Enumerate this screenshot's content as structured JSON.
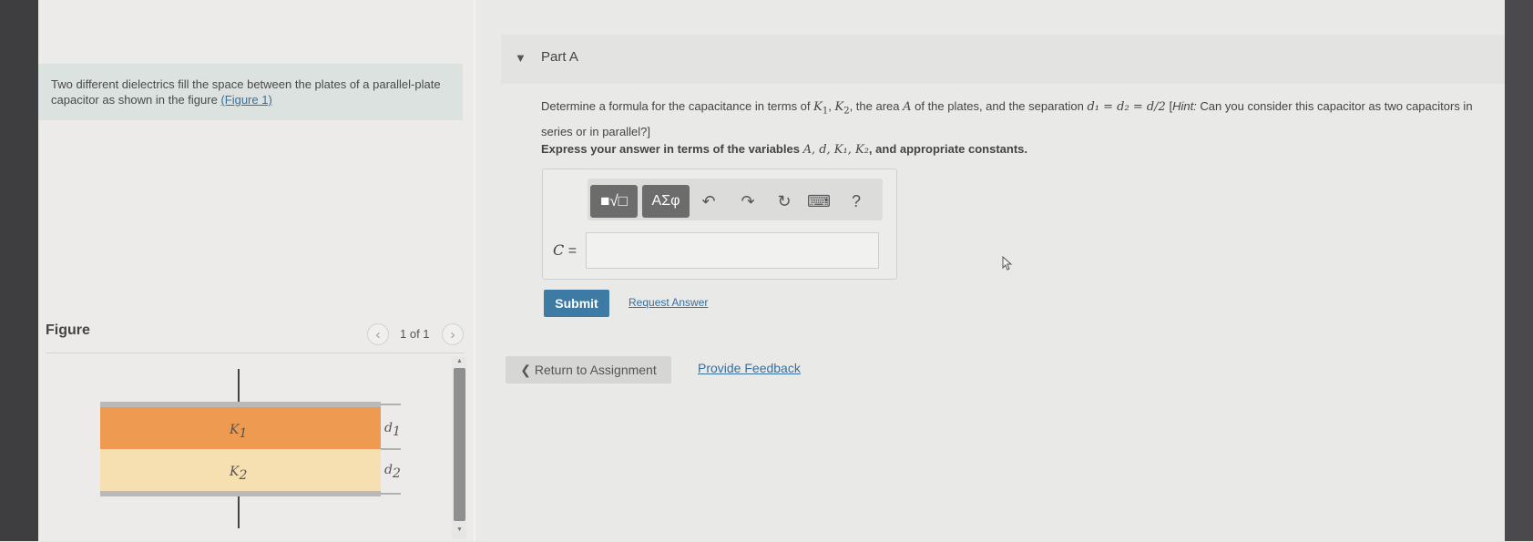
{
  "left_panel": {
    "intro_text": "Two different dielectrics fill the space between the plates of a parallel-plate capacitor as shown in the figure ",
    "intro_link": "(Figure 1)",
    "figure_title": "Figure",
    "figure_pager": "1 of 1",
    "prev_icon": "chevron-left-icon",
    "next_icon": "chevron-right-icon"
  },
  "figure": {
    "layers": [
      {
        "label": "K",
        "sub": "1",
        "color": "#ef9a51",
        "thickness_label": "d",
        "thickness_sub": "1"
      },
      {
        "label": "K",
        "sub": "2",
        "color": "#f6dfb1",
        "thickness_label": "d",
        "thickness_sub": "2"
      }
    ],
    "plate_color": "#b9b9b9"
  },
  "part_a": {
    "title": "Part A",
    "question_1": "Determine a formula for the capacitance in terms of ",
    "q_K1": "K",
    "q_K1_sub": "1",
    "q_K2": "K",
    "q_K2_sub": "2",
    "question_2": ", the area ",
    "q_A": "A",
    "question_3": " of the plates, and the separation ",
    "q_eq": "d₁ = d₂ = d/2",
    "question_4": " [",
    "q_hint": "Hint:",
    "question_5": " Can you consider this capacitor as two capacitors in series or in parallel?]",
    "instruction_prefix": "Express your answer in terms of the variables ",
    "instruction_vars": "A, d, K₁, K₂",
    "instruction_suffix": ", and appropriate constants.",
    "toolbar": {
      "template_label": "■√□",
      "greek_label": "ΑΣφ",
      "undo_symbol": "↶",
      "redo_symbol": "↷",
      "reset_symbol": "↻",
      "keyboard_symbol": "⌨",
      "help_symbol": "?"
    },
    "answer_label": "C",
    "answer_equals": " =",
    "answer_value": "",
    "submit_label": "Submit",
    "request_label": "Request Answer"
  },
  "footer": {
    "return_label": "❮ Return to Assignment",
    "feedback_label": "Provide Feedback"
  },
  "colors": {
    "accent": "#3d7aa4",
    "link": "#3a6f9c",
    "intro_bg": "#dbe2df"
  }
}
